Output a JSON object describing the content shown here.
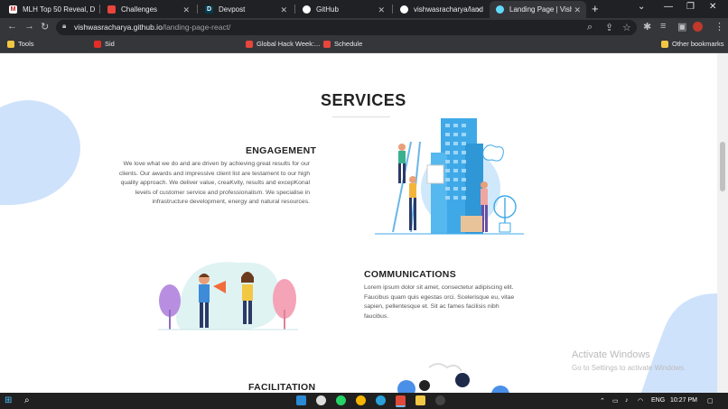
{
  "browser": {
    "tabs": [
      {
        "title": "MLH Top 50 Reveal, D"
      },
      {
        "title": "Challenges"
      },
      {
        "title": "Devpost"
      },
      {
        "title": "GitHub"
      },
      {
        "title": "vishwasracharya/land"
      },
      {
        "title": "Landing Page | Vishw"
      }
    ],
    "url_host": "vishwasracharya.github.io",
    "url_path": "/landing-page-react/",
    "bookmarks": {
      "tools": "Tools",
      "sid": "Sid",
      "global_hack_week": "Global Hack Week:...",
      "schedule": "Schedule",
      "other": "Other bookmarks"
    }
  },
  "page": {
    "title": "SERVICES",
    "sections": [
      {
        "heading": "ENGAGEMENT",
        "lines": [
          "We love what we do and are driven by achieving great results for our",
          "clients. Our awards and impressive client list are testament to our high",
          "quality approach. We deliver value, creaKvity, results and excepKonal",
          "levels of customer service and professionalism. We specialise in",
          "infrastructure development, energy and natural resources."
        ]
      },
      {
        "heading": "COMMUNICATIONS",
        "lines": [
          "Lorem ipsum dolor sit amet, consectetur adipiscing elit.",
          "Faucibus quam quis egestas orci. Scelerisque eu, vitae",
          "sapien, pellentesque et. Sit ac fames facilisis nibh",
          "faucibus."
        ]
      },
      {
        "heading": "FACILITATION"
      }
    ]
  },
  "watermark": {
    "line1": "Activate Windows",
    "line2": "Go to Settings to activate Windows."
  },
  "taskbar": {
    "lang": "ENG",
    "time": "10:27 PM"
  },
  "colors": {
    "accent_blob": "#cfe2fb",
    "building": "#3fa9e8"
  }
}
